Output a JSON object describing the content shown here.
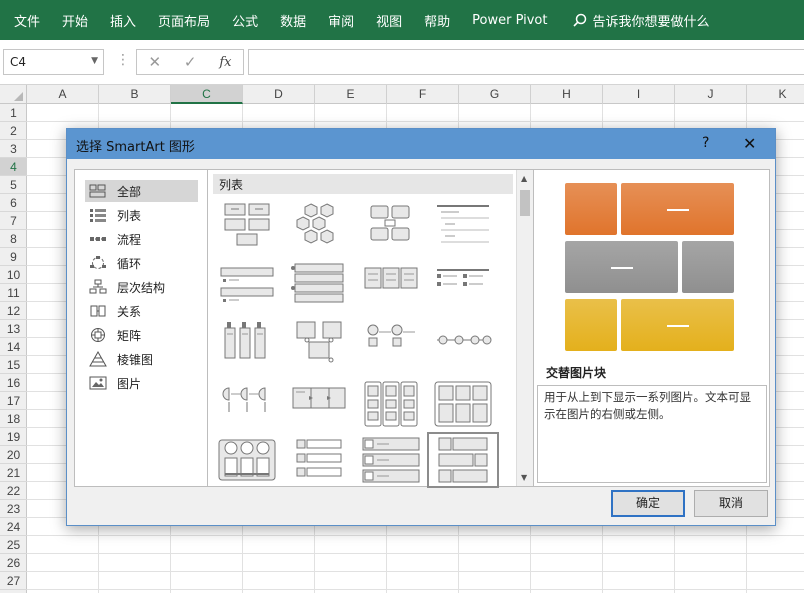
{
  "ribbon": {
    "tabs": [
      "文件",
      "开始",
      "插入",
      "页面布局",
      "公式",
      "数据",
      "审阅",
      "视图",
      "帮助",
      "Power Pivot"
    ],
    "tell_me": "告诉我你想要做什么",
    "color": "#217346"
  },
  "formula_bar": {
    "name_box": "C4",
    "fx": "fx",
    "cancel_symbol": "✕",
    "enter_symbol": "✓",
    "value": ""
  },
  "grid": {
    "columns": [
      "A",
      "B",
      "C",
      "D",
      "E",
      "F",
      "G",
      "H",
      "I",
      "J",
      "K"
    ],
    "rows": [
      "1",
      "2",
      "3",
      "4",
      "5",
      "6",
      "7",
      "8",
      "9",
      "10",
      "11",
      "12",
      "13",
      "14",
      "15",
      "16",
      "17",
      "18",
      "19",
      "20",
      "21",
      "22",
      "23",
      "24",
      "25",
      "26",
      "27"
    ],
    "selected_column": "C",
    "selected_row": "4"
  },
  "dialog": {
    "title": "选择 SmartArt 图形",
    "help": "?",
    "close": "✕",
    "categories": [
      {
        "label": "全部",
        "icon": "all-icon",
        "selected": true
      },
      {
        "label": "列表",
        "icon": "list-icon"
      },
      {
        "label": "流程",
        "icon": "process-icon"
      },
      {
        "label": "循环",
        "icon": "cycle-icon"
      },
      {
        "label": "层次结构",
        "icon": "hierarchy-icon"
      },
      {
        "label": "关系",
        "icon": "relationship-icon"
      },
      {
        "label": "矩阵",
        "icon": "matrix-icon"
      },
      {
        "label": "棱锥图",
        "icon": "pyramid-icon"
      },
      {
        "label": "图片",
        "icon": "picture-icon"
      }
    ],
    "gallery_header": "列表",
    "gallery_selected_index": 19,
    "preview_title": "交替图片块",
    "preview_description": "用于从上到下显示一系列图片。文本可显示在图片的右侧或左侧。",
    "preview_colors": [
      "#e0742c",
      "#8f8f8f",
      "#e4b01c"
    ],
    "ok": "确定",
    "cancel": "取消"
  }
}
